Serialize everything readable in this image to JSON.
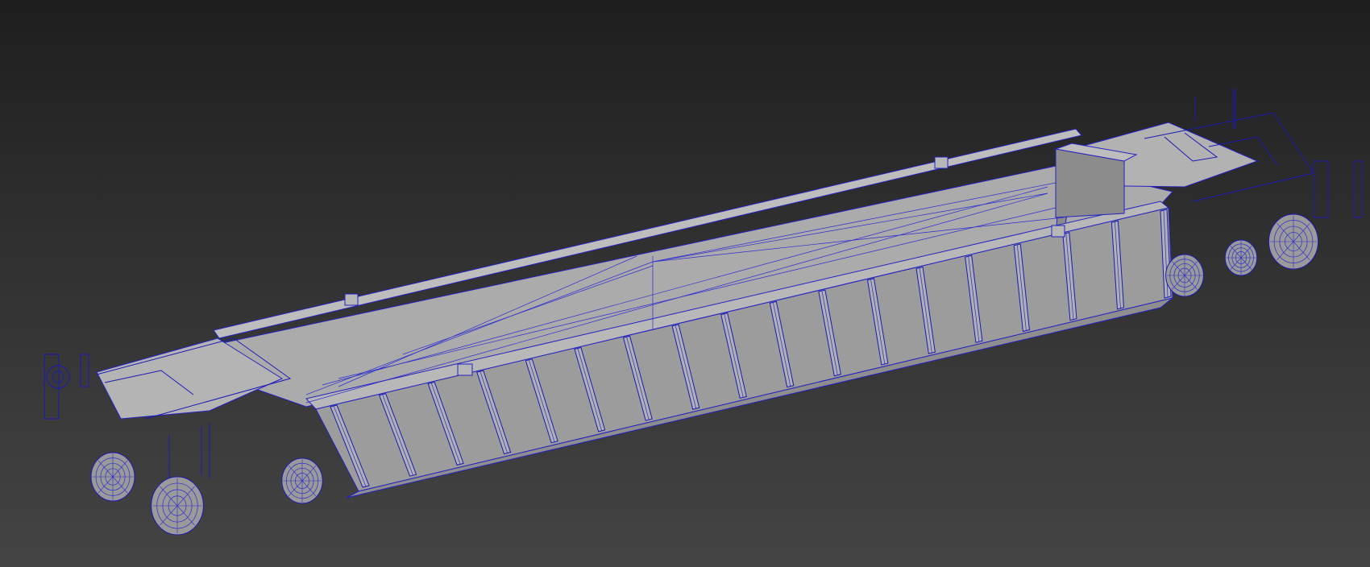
{
  "viewport": {
    "background_top": "#1e1e1e",
    "background_bottom": "#444444",
    "shading_mode": "shaded-with-edged-faces"
  },
  "model": {
    "object": "flatcar-wireframe",
    "face_color": "#a3a3a3",
    "face_color_light": "#b4b4b4",
    "face_color_dark": "#7e7e7e",
    "edge_color": "#1a1ab4"
  }
}
